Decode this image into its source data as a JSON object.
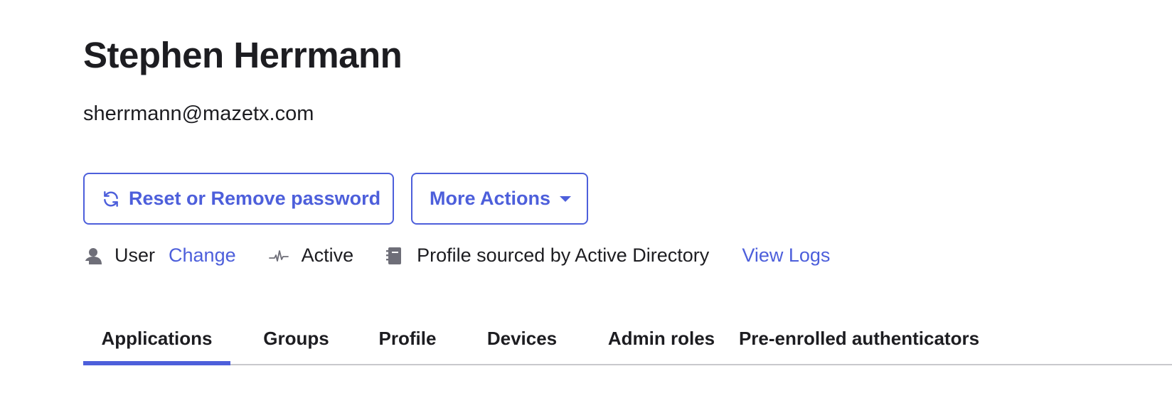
{
  "user": {
    "name": "Stephen Herrmann",
    "email": "sherrmann@mazetx.com"
  },
  "actions": {
    "reset_label": "Reset or Remove password",
    "more_label": "More Actions"
  },
  "meta": {
    "role_label": "User",
    "change_link": "Change",
    "status_label": "Active",
    "source_label": "Profile sourced by Active Directory",
    "logs_link": "View Logs"
  },
  "tabs": [
    {
      "label": "Applications",
      "active": true
    },
    {
      "label": "Groups",
      "active": false
    },
    {
      "label": "Profile",
      "active": false
    },
    {
      "label": "Devices",
      "active": false
    },
    {
      "label": "Admin roles",
      "active": false
    },
    {
      "label": "Pre-enrolled authenticators",
      "active": false
    }
  ],
  "icons": {
    "reset": "refresh-icon",
    "more": "caret-down-icon",
    "role": "user-icon",
    "status": "activity-pulse-icon",
    "source": "directory-book-icon"
  },
  "colors": {
    "accent": "#4d5fdb",
    "text": "#1d1d21",
    "icon_gray": "#6e6e78",
    "divider": "#c8c8cc"
  }
}
